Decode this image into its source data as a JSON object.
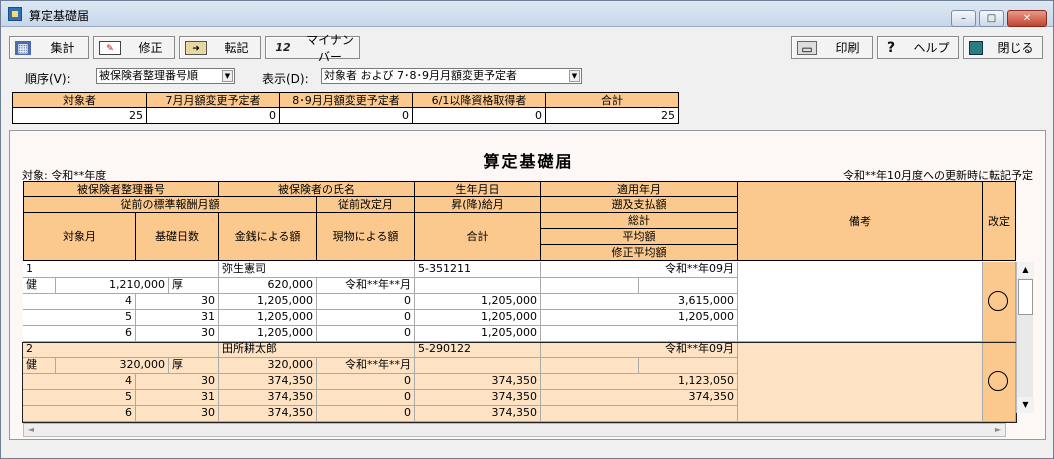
{
  "window": {
    "title": "算定基礎届",
    "min": "–",
    "max": "□",
    "close": "✕"
  },
  "toolbar": {
    "calc": "集計",
    "edit": "修正",
    "tenki": "転記",
    "mynumber": "マイナンバー",
    "print": "印刷",
    "help": "ヘルプ",
    "close": "閉じる",
    "mynumber_icon_text": "12"
  },
  "filters": {
    "order_label": "順序(V):",
    "order_value": "被保険者整理番号順",
    "display_label": "表示(D):",
    "display_value": "対象者 および 7･8･9月月額変更予定者"
  },
  "summary": {
    "headers": [
      "対象者",
      "7月月額変更予定者",
      "8･9月月額変更予定者",
      "6/1以降資格取得者",
      "合計"
    ],
    "values": [
      "25",
      "0",
      "0",
      "0",
      "25"
    ]
  },
  "report": {
    "title": "算定基礎届",
    "target": "対象:  令和**年度",
    "note": "令和**年10月度への更新時に転記予定",
    "headers": {
      "insured_no": "被保険者整理番号",
      "insured_name": "被保険者の氏名",
      "birth": "生年月日",
      "applied": "適用年月",
      "prev_monthly": "従前の標準報酬月額",
      "prev_revision": "従前改定月",
      "raise": "昇(降)給月",
      "retro": "遡及支払額",
      "month": "対象月",
      "days": "基礎日数",
      "money": "金銭による額",
      "kind": "現物による額",
      "total": "合計",
      "sum": "総計",
      "avg": "平均額",
      "mod_avg": "修正平均額",
      "remarks": "備考",
      "revise": "改定"
    },
    "records": [
      {
        "no": "1",
        "name": "弥生憲司",
        "birth": "5-351211",
        "applied": "令和**年09月",
        "ken": "健",
        "ken_amt": "1,210,000",
        "kou": "厚",
        "kou_amt": "620,000",
        "prev_rev": "令和**年**月",
        "rows": [
          [
            "4",
            "30",
            "1,205,000",
            "0",
            "1,205,000",
            "3,615,000"
          ],
          [
            "5",
            "31",
            "1,205,000",
            "0",
            "1,205,000",
            "1,205,000"
          ],
          [
            "6",
            "30",
            "1,205,000",
            "0",
            "1,205,000",
            ""
          ]
        ]
      },
      {
        "no": "2",
        "name": "田所耕太郎",
        "birth": "5-290122",
        "applied": "令和**年09月",
        "ken": "健",
        "ken_amt": "320,000",
        "kou": "厚",
        "kou_amt": "320,000",
        "prev_rev": "令和**年**月",
        "rows": [
          [
            "4",
            "30",
            "374,350",
            "0",
            "374,350",
            "1,123,050"
          ],
          [
            "5",
            "31",
            "374,350",
            "0",
            "374,350",
            "374,350"
          ],
          [
            "6",
            "30",
            "374,350",
            "0",
            "374,350",
            ""
          ]
        ]
      }
    ]
  },
  "scroll": {
    "up": "▲",
    "down": "▼",
    "left": "◄",
    "right": "►"
  }
}
